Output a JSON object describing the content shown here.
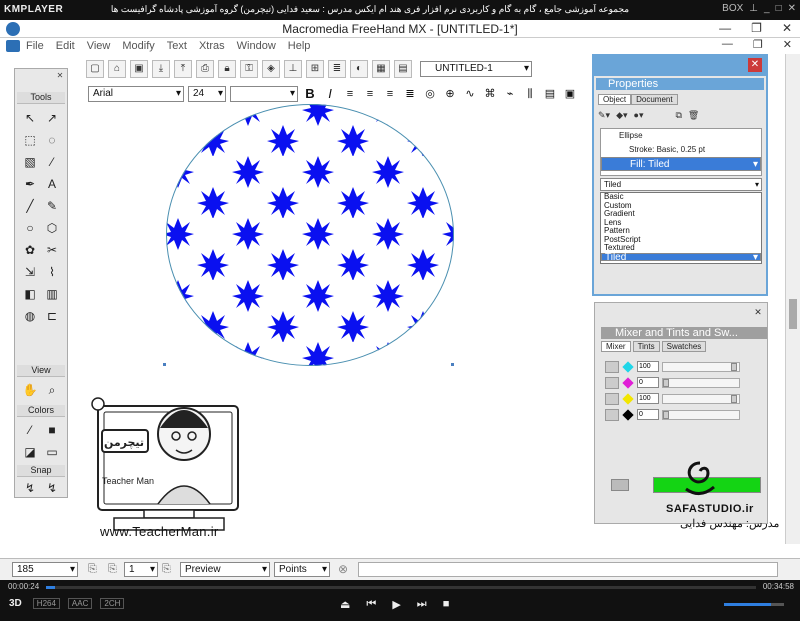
{
  "player": {
    "name": "KMPLAYER",
    "title": "مجموعه آموزشی جامع ، گام به گام و کاربردی نرم افزار فری هند ام ایکس    مدرس : سعید فدایی (تیچرمن) گروه آموزشی پادشاه گرافیست ها",
    "box_label": "BOX",
    "time_elapsed": "00:00:24",
    "time_total": "00:34:58",
    "progress_percent": 1.2,
    "volume_percent": 78,
    "badges": [
      "H264",
      "AAC",
      "2CH"
    ],
    "logo_3d": "3D"
  },
  "window": {
    "title": "Macromedia FreeHand MX - [UNTITLED-1*]",
    "controls": [
      "—",
      "❐",
      "✕"
    ]
  },
  "menubar": {
    "items": [
      "File",
      "Edit",
      "View",
      "Modify",
      "Text",
      "Xtras",
      "Window",
      "Help"
    ]
  },
  "toolbar": {
    "document_select": "UNTITLED-1",
    "font_select": "Arial",
    "size_select": "24",
    "bold": "B",
    "italic": "I"
  },
  "tools_panel": {
    "title": "Tools",
    "view_label": "View",
    "colors_label": "Colors",
    "snap_label": "Snap"
  },
  "properties": {
    "title": "Properties",
    "tabs": [
      "Object",
      "Document"
    ],
    "object_list": [
      "Ellipse",
      "Stroke: Basic, 0.25 pt",
      "Fill: Tiled"
    ],
    "fill_type": "Tiled",
    "fill_options": [
      "Basic",
      "Custom",
      "Gradient",
      "Lens",
      "Pattern",
      "PostScript",
      "Textured",
      "Tiled"
    ],
    "selected_option": "Tiled"
  },
  "mixer": {
    "title": "Mixer and Tints and Sw...",
    "tabs": [
      "Mixer",
      "Tints",
      "Swatches"
    ],
    "channels": [
      {
        "color": "#1fd6e8",
        "value": "100"
      },
      {
        "color": "#e01fd6",
        "value": "0"
      },
      {
        "color": "#f2e600",
        "value": "100"
      },
      {
        "color": "#000000",
        "value": "0"
      }
    ],
    "preview_color": "#14d414"
  },
  "branding": {
    "site": "www.TeacherMan.ir",
    "teacher_en": "Teacher Man",
    "teacher_fa": "تیچرمن",
    "studio": "SAFASTUDIO.ir",
    "teacher_line": "مدرس: مهندس فدایی"
  },
  "statusbar": {
    "zoom": "185",
    "page": "1",
    "preview_mode": "Preview",
    "units": "Points"
  },
  "colors": {
    "star_blue": "#0a10f0",
    "panel_blue": "#6aa5d8"
  }
}
